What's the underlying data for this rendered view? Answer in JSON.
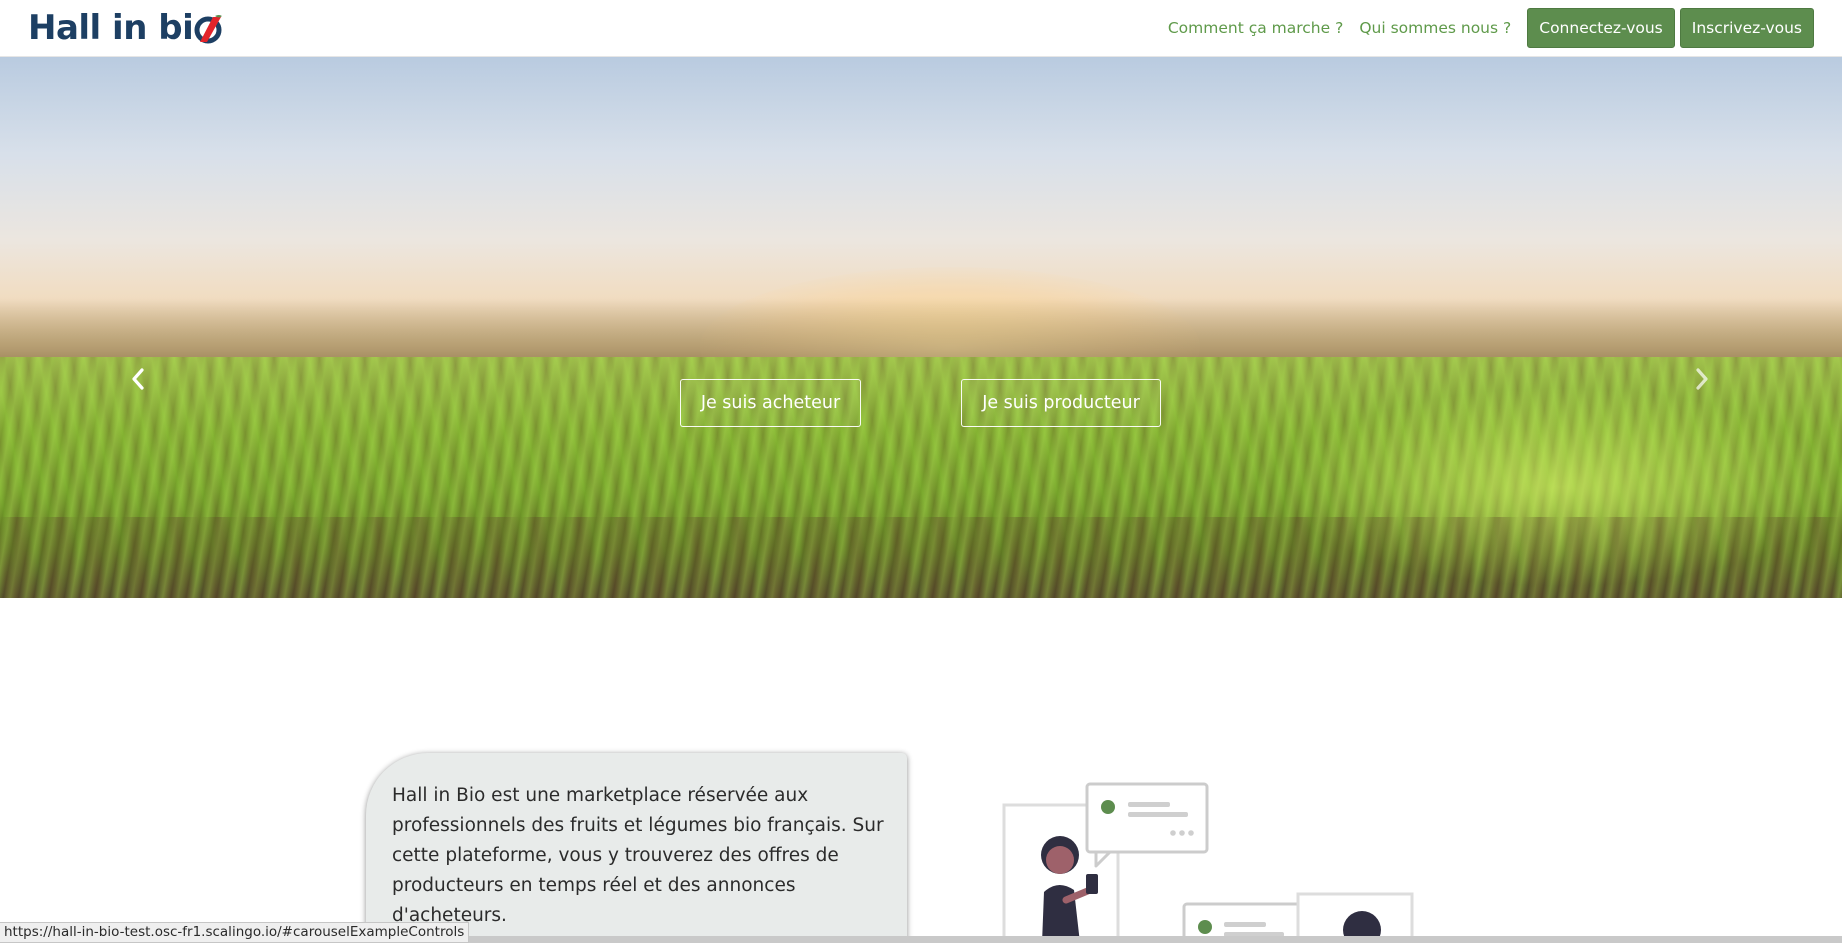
{
  "brand": {
    "text": "Hall in bi",
    "logo_colors": {
      "navy": "#1d3f63",
      "red": "#e2242b"
    }
  },
  "nav": {
    "links": [
      {
        "label": "Comment ça marche ?"
      },
      {
        "label": "Qui sommes nous ?"
      }
    ],
    "login_button": "Connectez-vous",
    "signup_button": "Inscrivez-vous",
    "accent_color": "#5d8d4e"
  },
  "hero": {
    "buyer_button": "Je suis acheteur",
    "producer_button": "Je suis producteur",
    "prev_icon": "chevron-left-icon",
    "next_icon": "chevron-right-icon"
  },
  "intro": {
    "text": "Hall in Bio est une marketplace réservée aux professionnels des fruits et légumes bio français. Sur cette plateforme, vous y trouverez des offres de producteurs en temps réel et des annonces d'acheteurs."
  },
  "status_bar": {
    "url": "https://hall-in-bio-test.osc-fr1.scalingo.io/#carouselExampleControls"
  }
}
